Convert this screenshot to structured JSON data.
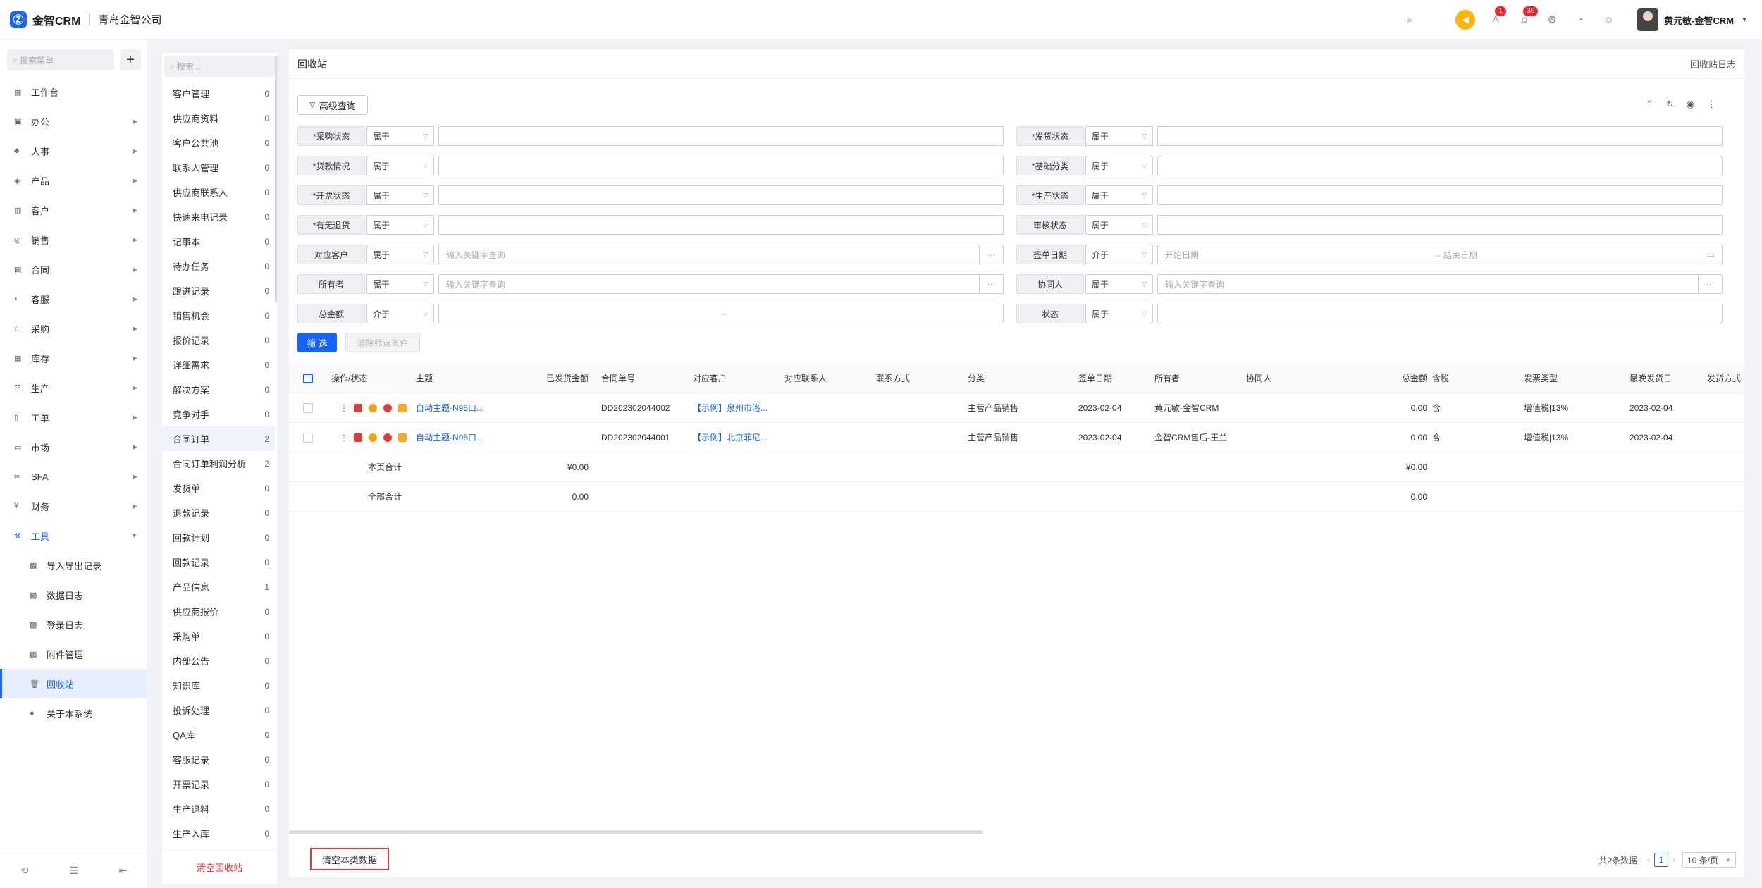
{
  "topbar": {
    "app_name": "金智CRM",
    "company": "青岛金智公司",
    "badge_tasks": "1",
    "badge_notices": "30",
    "user": "黄元敏-金智CRM"
  },
  "menu": {
    "search_placeholder": "搜索菜单",
    "items": [
      "工作台",
      "办公",
      "人事",
      "产品",
      "客户",
      "销售",
      "合同",
      "客服",
      "采购",
      "库存",
      "生产",
      "工单",
      "市场",
      "SFA",
      "财务",
      "工具"
    ],
    "tools_sub": [
      "导入导出记录",
      "数据日志",
      "登录日志",
      "附件管理",
      "回收站",
      "关于本系统"
    ]
  },
  "categories": {
    "search_placeholder": "搜索...",
    "items": [
      {
        "name": "客户管理",
        "count": "0"
      },
      {
        "name": "供应商资料",
        "count": "0"
      },
      {
        "name": "客户公共池",
        "count": "0"
      },
      {
        "name": "联系人管理",
        "count": "0"
      },
      {
        "name": "供应商联系人",
        "count": "0"
      },
      {
        "name": "快速来电记录",
        "count": "0"
      },
      {
        "name": "记事本",
        "count": "0"
      },
      {
        "name": "待办任务",
        "count": "0"
      },
      {
        "name": "跟进记录",
        "count": "0"
      },
      {
        "name": "销售机会",
        "count": "0"
      },
      {
        "name": "报价记录",
        "count": "0"
      },
      {
        "name": "详细需求",
        "count": "0"
      },
      {
        "name": "解决方案",
        "count": "0"
      },
      {
        "name": "竞争对手",
        "count": "0"
      },
      {
        "name": "合同订单",
        "count": "2"
      },
      {
        "name": "合同订单利润分析",
        "count": "2"
      },
      {
        "name": "发货单",
        "count": "0"
      },
      {
        "name": "退款记录",
        "count": "0"
      },
      {
        "name": "回款计划",
        "count": "0"
      },
      {
        "name": "回款记录",
        "count": "0"
      },
      {
        "name": "产品信息",
        "count": "1"
      },
      {
        "name": "供应商报价",
        "count": "0"
      },
      {
        "name": "采购单",
        "count": "0"
      },
      {
        "name": "内部公告",
        "count": "0"
      },
      {
        "name": "知识库",
        "count": "0"
      },
      {
        "name": "投诉处理",
        "count": "0"
      },
      {
        "name": "QA库",
        "count": "0"
      },
      {
        "name": "客服记录",
        "count": "0"
      },
      {
        "name": "开票记录",
        "count": "0"
      },
      {
        "name": "生产退料",
        "count": "0"
      },
      {
        "name": "生产入库",
        "count": "0"
      }
    ],
    "clear_bin": "清空回收站"
  },
  "main": {
    "title": "回收站",
    "log_link": "回收站日志",
    "advanced": "高级查询",
    "filters_left": [
      {
        "label": "*采购状态",
        "op": "属于",
        "ph": ""
      },
      {
        "label": "*货款情况",
        "op": "属于",
        "ph": ""
      },
      {
        "label": "*开票状态",
        "op": "属于",
        "ph": ""
      },
      {
        "label": "*有无退货",
        "op": "属于",
        "ph": ""
      },
      {
        "label": "对应客户",
        "op": "属于",
        "ph": "输入关键字查询"
      },
      {
        "label": "所有者",
        "op": "属于",
        "ph": "输入关键字查询"
      },
      {
        "label": "总金额",
        "op": "介于",
        "ph": "--"
      }
    ],
    "filters_right": [
      {
        "label": "*发货状态",
        "op": "属于",
        "ph": ""
      },
      {
        "label": "*基础分类",
        "op": "属于",
        "ph": ""
      },
      {
        "label": "*生产状态",
        "op": "属于",
        "ph": ""
      },
      {
        "label": "审核状态",
        "op": "属于",
        "ph": ""
      },
      {
        "label": "签单日期",
        "op": "介于",
        "ph": "开始日期"
      },
      {
        "label": "协同人",
        "op": "属于",
        "ph": "输入关键字查询"
      },
      {
        "label": "状态",
        "op": "属于",
        "ph": ""
      }
    ],
    "date_end": "结束日期",
    "btn_filter": "筛 选",
    "btn_clear": "清除筛选条件"
  },
  "table": {
    "headers": {
      "op": "操作/状态",
      "subject": "主题",
      "shipped": "已发货金额",
      "contract_no": "合同单号",
      "customer": "对应客户",
      "contact": "对应联系人",
      "phone": "联系方式",
      "category": "分类",
      "sign_date": "签单日期",
      "owner": "所有者",
      "collab": "协同人",
      "total": "总金额",
      "tax": "含税",
      "invoice": "发票类型",
      "last_ship": "最晚发货日",
      "ship_method": "发货方式"
    },
    "rows": [
      {
        "subject": "自动主题-N95口...",
        "shipped": "",
        "contract_no": "DD202302044002",
        "customer": "【示例】泉州市洛...",
        "category": "主营产品销售",
        "sign_date": "2023-02-04",
        "owner": "黄元敏-金智CRM",
        "total": "0.00",
        "tax": "含",
        "invoice": "增值税|13%",
        "last_ship": "2023-02-04"
      },
      {
        "subject": "自动主题-N95口...",
        "shipped": "",
        "contract_no": "DD202302044001",
        "customer": "【示例】北京菲尼...",
        "category": "主营产品销售",
        "sign_date": "2023-02-04",
        "owner": "金智CRM售后-王兰",
        "total": "0.00",
        "tax": "含",
        "invoice": "增值税|13%",
        "last_ship": "2023-02-04"
      }
    ],
    "page_total_label": "本页合计",
    "page_total_shipped": "¥0.00",
    "page_total_amount": "¥0.00",
    "all_total_label": "全部合计",
    "all_total_shipped": "0.00",
    "all_total_amount": "0.00"
  },
  "footer": {
    "clear_cat": "清空本类数据",
    "total": "共2条数据",
    "page": "1",
    "page_size": "10 条/页"
  }
}
